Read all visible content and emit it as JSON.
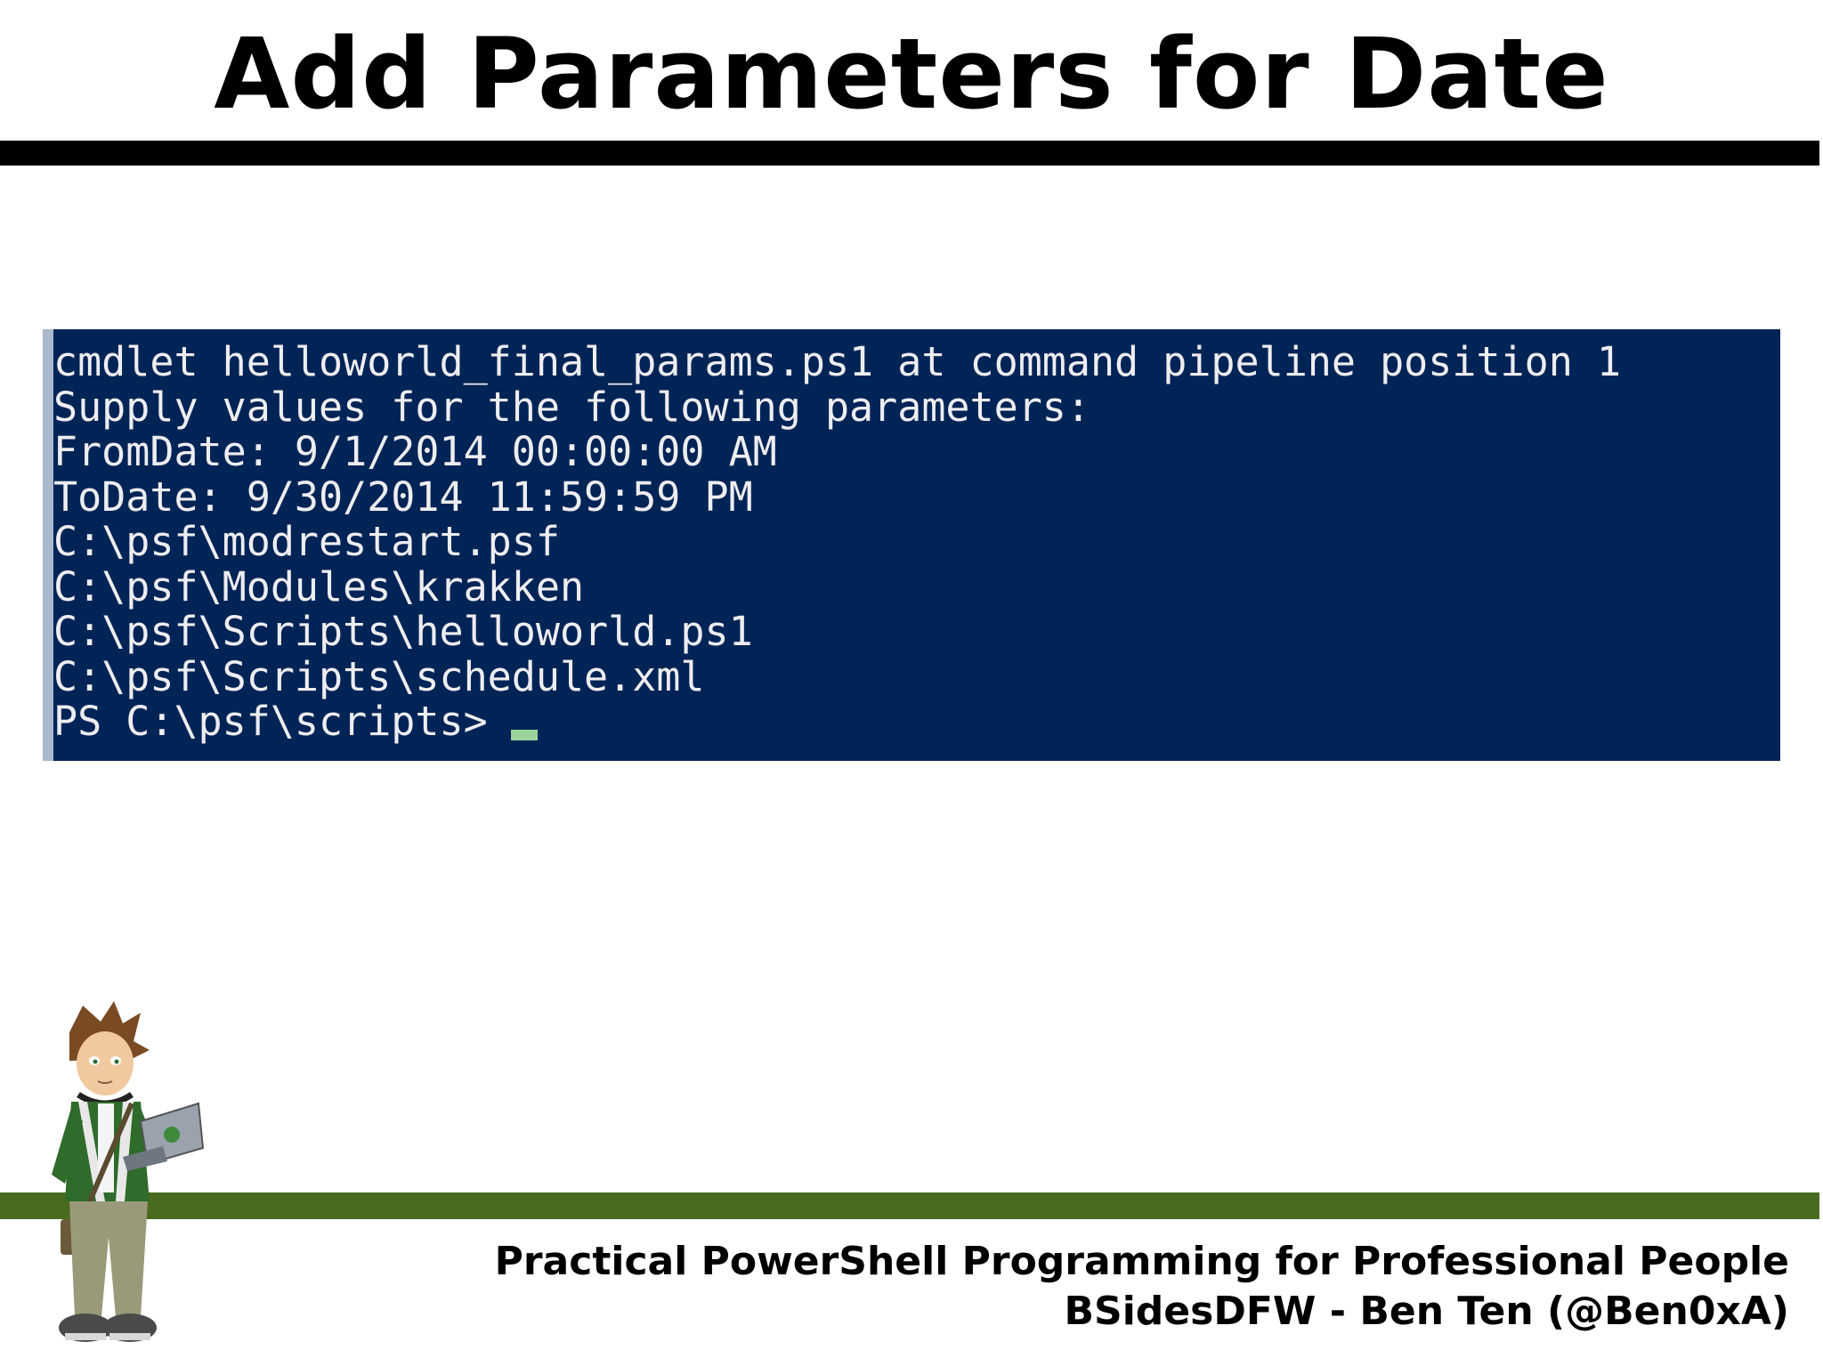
{
  "slide": {
    "title": "Add Parameters for Date"
  },
  "console": {
    "lines": [
      "cmdlet helloworld_final_params.ps1 at command pipeline position 1",
      "Supply values for the following parameters:",
      "FromDate: 9/1/2014 00:00:00 AM",
      "ToDate: 9/30/2014 11:59:59 PM",
      "C:\\psf\\modrestart.psf",
      "C:\\psf\\Modules\\krakken",
      "C:\\psf\\Scripts\\helloworld.ps1",
      "C:\\psf\\Scripts\\schedule.xml",
      "PS C:\\psf\\scripts>"
    ],
    "background_color": "#012456",
    "text_color": "#eeedf0"
  },
  "footer": {
    "line1": "Practical PowerShell Programming for Professional People",
    "line2": "BSidesDFW - Ben Ten (@Ben0xA)"
  },
  "mascot": {
    "icon": "cartoon-hacker-with-laptop"
  }
}
